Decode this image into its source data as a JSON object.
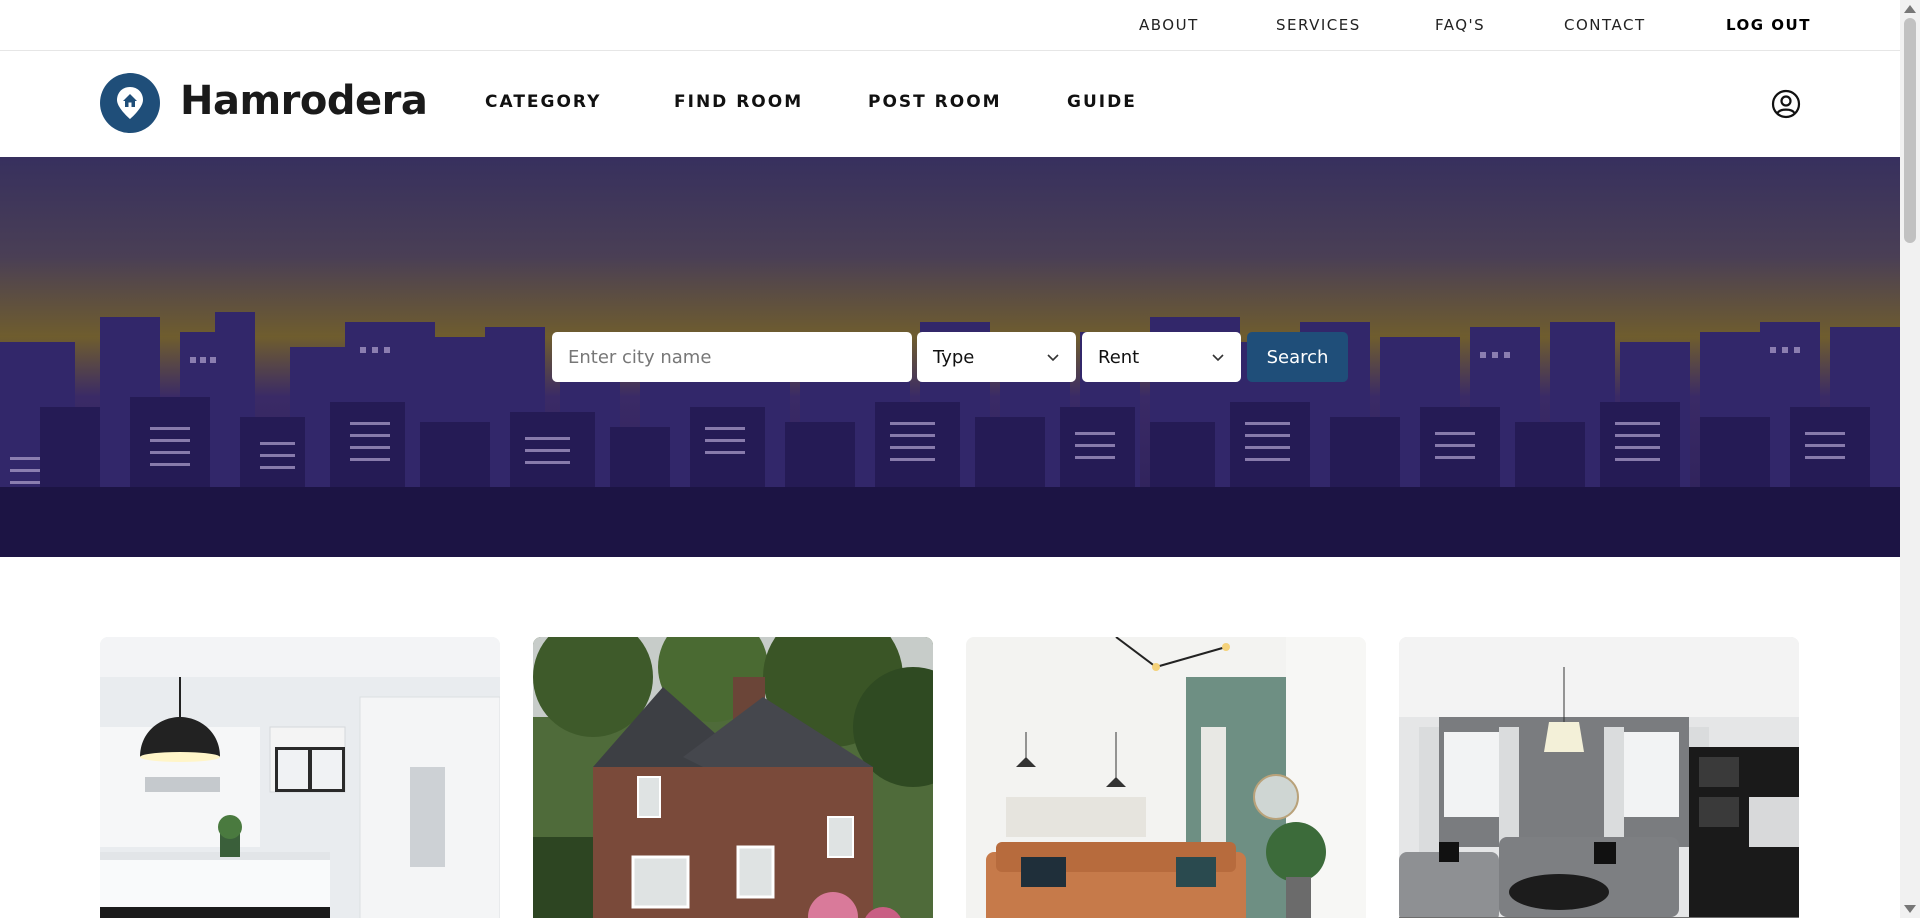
{
  "top_nav": {
    "about": "ABOUT",
    "services": "SERVICES",
    "faqs": "FAQ'S",
    "contact": "CONTACT",
    "logout": "LOG OUT"
  },
  "header": {
    "brand": "Hamrodera",
    "logo_icon": "home-pin-icon",
    "nav": {
      "category": "CATEGORY",
      "find_room": "FIND ROOM",
      "post_room": "POST ROOM",
      "guide": "GUIDE"
    },
    "account_icon": "user-circle-icon"
  },
  "search": {
    "city_placeholder": "Enter city name",
    "type_value": "Type",
    "rent_value": "Rent",
    "button_label": "Search"
  },
  "cards": [
    {
      "image": "white-kitchen-with-pendant-lamp"
    },
    {
      "image": "brick-cottage-with-trees"
    },
    {
      "image": "living-room-with-orange-sofa"
    },
    {
      "image": "grey-living-room-with-sofas"
    }
  ],
  "colors": {
    "brand_blue": "#1f4e79",
    "hero_sky_top": "#37305e",
    "hero_horizon": "#6f5d2e",
    "hero_buildings": "#2a1f55"
  }
}
